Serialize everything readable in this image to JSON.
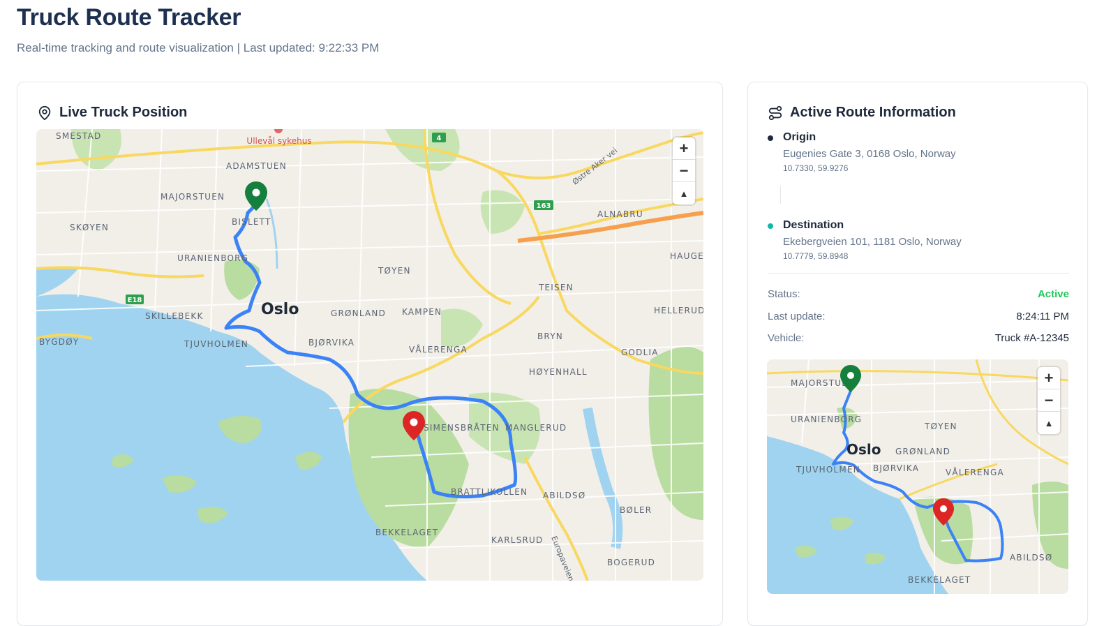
{
  "header": {
    "title": "Truck Route Tracker",
    "subtitle": "Real-time tracking and route visualization | Last updated: 9:22:33 PM"
  },
  "main_card": {
    "title": "Live Truck Position",
    "icon": "map-pin-icon",
    "map": {
      "zoom_in": "+",
      "zoom_out": "−",
      "reset_north": "▲",
      "city_label": "Oslo",
      "hospital_label": "Ullevål sykehus",
      "road_badges": [
        "4",
        "163",
        "E18"
      ],
      "road_names": [
        "Østre Aker vei",
        "Europaveien"
      ],
      "districts": [
        "SMESTAD",
        "ADAMSTUEN",
        "MAJORSTUEN",
        "SKØYEN",
        "BISLETT",
        "URANIENBORG",
        "SKILLEBEKK",
        "BYGDØY",
        "TJUVHOLMEN",
        "TØYEN",
        "GRØNLAND",
        "KAMPEN",
        "BJØRVIKA",
        "VÅLERENGA",
        "TEISEN",
        "BRYN",
        "HØYENHALL",
        "GODLIA",
        "ALNABRU",
        "HAUGE",
        "HELLERUD",
        "SIMENSBRÅTEN",
        "MANGLERUD",
        "BRATTLIKOLLEN",
        "ABILDSØ",
        "BØLER",
        "BEKKELAGET",
        "KARLSRUD",
        "BOGERUD"
      ]
    }
  },
  "side_card": {
    "title": "Active Route Information",
    "icon": "route-icon",
    "origin": {
      "label": "Origin",
      "address": "Eugenies Gate 3, 0168 Oslo, Norway",
      "coords": "10.7330, 59.9276",
      "color": "#1e293b"
    },
    "destination": {
      "label": "Destination",
      "address": "Ekebergveien 101, 1181 Oslo, Norway",
      "coords": "10.7779, 59.8948",
      "color": "#14b8a6"
    },
    "status": {
      "label": "Status:",
      "value": "Active",
      "color": "#22c55e"
    },
    "last_update": {
      "label": "Last update:",
      "value": "8:24:11 PM"
    },
    "vehicle": {
      "label": "Vehicle:",
      "value": "Truck #A-12345"
    },
    "mini_map": {
      "zoom_in": "+",
      "zoom_out": "−",
      "reset_north": "▲",
      "city_label": "Oslo",
      "districts": [
        "MAJORSTUEN",
        "URANIENBORG",
        "TØYEN",
        "GRØNLAND",
        "TJUVHOLMEN",
        "BJØRVIKA",
        "VÅLERENGA",
        "ABILDSØ",
        "BEKKELAGET"
      ]
    }
  },
  "colors": {
    "route": "#3b82f6",
    "origin_marker": "#15803d",
    "destination_marker": "#dc2626",
    "water": "#9fd3f0",
    "park": "#b9dca0",
    "land": "#f2efe9",
    "major_road": "#f8d860"
  }
}
